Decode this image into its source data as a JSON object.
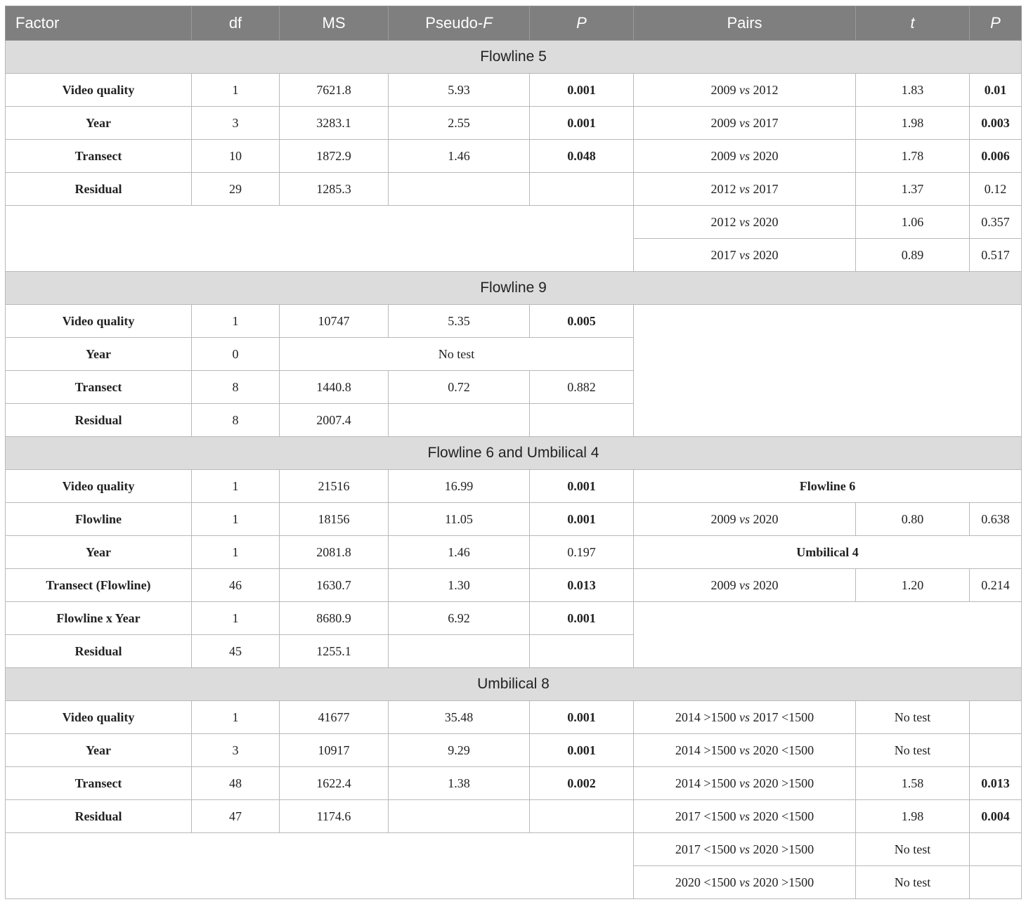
{
  "headers": {
    "factor": "Factor",
    "df": "df",
    "ms": "MS",
    "pseudo_f_prefix": "Pseudo-",
    "pseudo_f_italic": "F",
    "p": "P",
    "pairs": "Pairs",
    "t": "t",
    "p2": "P"
  },
  "vs": "vs",
  "sections": [
    {
      "title": "Flowline 5",
      "rows": [
        {
          "factor": "Video quality",
          "df": "1",
          "ms": "7621.8",
          "pf": "5.93",
          "p": "0.001"
        },
        {
          "factor": "Year",
          "df": "3",
          "ms": "3283.1",
          "pf": "2.55",
          "p": "0.001"
        },
        {
          "factor": "Transect",
          "df": "10",
          "ms": "1872.9",
          "pf": "1.46",
          "p": "0.048"
        },
        {
          "factor": "Residual",
          "df": "29",
          "ms": "1285.3",
          "pf": "",
          "p": ""
        }
      ],
      "pairs": [
        {
          "a": "2009",
          "b": "2012",
          "t": "1.83",
          "p": "0.01"
        },
        {
          "a": "2009",
          "b": "2017",
          "t": "1.98",
          "p": "0.003"
        },
        {
          "a": "2009",
          "b": "2020",
          "t": "1.78",
          "p": "0.006"
        },
        {
          "a": "2012",
          "b": "2017",
          "t": "1.37",
          "p": "0.12"
        },
        {
          "a": "2012",
          "b": "2020",
          "t": "1.06",
          "p": "0.357"
        },
        {
          "a": "2017",
          "b": "2020",
          "t": "0.89",
          "p": "0.517"
        }
      ]
    },
    {
      "title": "Flowline 9",
      "rows": [
        {
          "factor": "Video quality",
          "df": "1",
          "ms": "10747",
          "pf": "5.35",
          "p": "0.005"
        },
        {
          "factor": "Year",
          "df": "0",
          "no_test": "No test"
        },
        {
          "factor": "Transect",
          "df": "8",
          "ms": "1440.8",
          "pf": "0.72",
          "p": "0.882"
        },
        {
          "factor": "Residual",
          "df": "8",
          "ms": "2007.4",
          "pf": "",
          "p": ""
        }
      ]
    },
    {
      "title": "Flowline 6 and Umbilical 4",
      "rows": [
        {
          "factor": "Video quality",
          "df": "1",
          "ms": "21516",
          "pf": "16.99",
          "p": "0.001"
        },
        {
          "factor": "Flowline",
          "df": "1",
          "ms": "18156",
          "pf": "11.05",
          "p": "0.001"
        },
        {
          "factor": "Year",
          "df": "1",
          "ms": "2081.8",
          "pf": "1.46",
          "p": "0.197"
        },
        {
          "factor": "Transect (Flowline)",
          "df": "46",
          "ms": "1630.7",
          "pf": "1.30",
          "p": "0.013"
        },
        {
          "factor": "Flowline x Year",
          "df": "1",
          "ms": "8680.9",
          "pf": "6.92",
          "p": "0.001"
        },
        {
          "factor": "Residual",
          "df": "45",
          "ms": "1255.1",
          "pf": "",
          "p": ""
        }
      ],
      "pair_groups": [
        {
          "label": "Flowline 6",
          "a": "2009",
          "b": "2020",
          "t": "0.80",
          "p": "0.638"
        },
        {
          "label": "Umbilical 4",
          "a": "2009",
          "b": "2020",
          "t": "1.20",
          "p": "0.214"
        }
      ]
    },
    {
      "title": "Umbilical 8",
      "rows": [
        {
          "factor": "Video quality",
          "df": "1",
          "ms": "41677",
          "pf": "35.48",
          "p": "0.001"
        },
        {
          "factor": "Year",
          "df": "3",
          "ms": "10917",
          "pf": "9.29",
          "p": "0.001"
        },
        {
          "factor": "Transect",
          "df": "48",
          "ms": "1622.4",
          "pf": "1.38",
          "p": "0.002"
        },
        {
          "factor": "Residual",
          "df": "47",
          "ms": "1174.6",
          "pf": "",
          "p": ""
        }
      ],
      "pairs": [
        {
          "a": "2014 >1500",
          "b": "2017 <1500",
          "t": "No test",
          "p": ""
        },
        {
          "a": "2014 >1500",
          "b": "2020 <1500",
          "t": "No test",
          "p": ""
        },
        {
          "a": "2014 >1500",
          "b": "2020 >1500",
          "t": "1.58",
          "p": "0.013"
        },
        {
          "a": "2017 <1500",
          "b": "2020 <1500",
          "t": "1.98",
          "p": "0.004"
        },
        {
          "a": "2017 <1500",
          "b": "2020 >1500",
          "t": "No test",
          "p": ""
        },
        {
          "a": "2020 <1500",
          "b": "2020 >1500",
          "t": "No test",
          "p": ""
        }
      ]
    }
  ]
}
